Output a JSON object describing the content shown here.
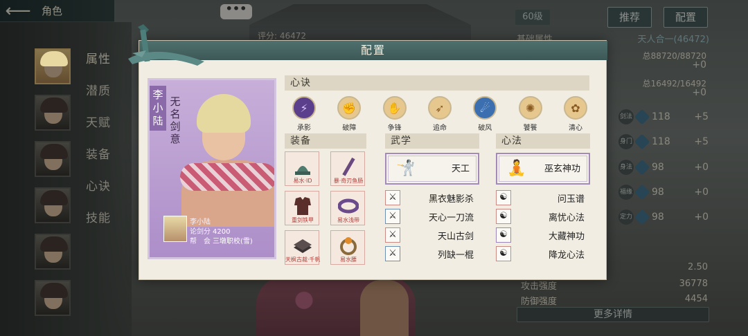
{
  "topbar": {
    "back_icon": "arrow-left-icon",
    "title": "角色"
  },
  "sidebar": {
    "menu": [
      "属性",
      "潜质",
      "天赋",
      "装备",
      "心诀",
      "技能"
    ]
  },
  "chat": {
    "label": "•••"
  },
  "background_panel": {
    "score": "评分: 46472",
    "level": "60级",
    "buttons": {
      "recommend": "推荐",
      "config": "配置"
    },
    "basic_attr": "基础属性",
    "realm": "天人合一(46472)",
    "hp": "总88720/88720",
    "hp_plus": "+0",
    "mp": "总16492/16492",
    "mp_plus": "+0",
    "attrs": [
      {
        "icon": "剑法",
        "value": "118",
        "plus": "+5"
      },
      {
        "icon": "身门",
        "value": "118",
        "plus": "+5"
      },
      {
        "icon": "身法",
        "value": "98",
        "plus": "+0"
      },
      {
        "icon": "福缘",
        "value": "98",
        "plus": "+0"
      },
      {
        "icon": "定力",
        "value": "98",
        "plus": "+0"
      }
    ],
    "bottom_stats": [
      {
        "label": "",
        "value": "2.50"
      },
      {
        "label": "攻击强度",
        "value": "36778"
      },
      {
        "label": "防御强度",
        "value": "4454"
      }
    ],
    "more": "更多详情"
  },
  "modal": {
    "title": "配置",
    "card": {
      "name": "李小陆",
      "title": "无名剑意",
      "info_name": "李小陆",
      "sword_label": "论剑分",
      "sword_value": "4200",
      "guild_label": "帮　会",
      "guild_value": "三墩职校(雪)"
    },
    "sections": {
      "xinjue": "心诀",
      "equip": "装备",
      "wuxue": "武学",
      "xinfa": "心法"
    },
    "xinjue": [
      {
        "label": "承影",
        "icon": "blade-icon",
        "color": "#5b3f8c"
      },
      {
        "label": "破障",
        "icon": "fist-icon",
        "color": "#c98b3d"
      },
      {
        "label": "争锋",
        "icon": "palm-icon",
        "color": "#c98b3d"
      },
      {
        "label": "追命",
        "icon": "strike-icon",
        "color": "#c98b3d"
      },
      {
        "label": "破风",
        "icon": "wind-icon",
        "color": "#3c6fb0"
      },
      {
        "label": "饕餮",
        "icon": "beast-icon",
        "color": "#c98b3d"
      },
      {
        "label": "清心",
        "icon": "lotus-icon",
        "color": "#c98b3d"
      }
    ],
    "equip": [
      {
        "label": "易水·ID",
        "shape": "hat"
      },
      {
        "label": "暴·奇刃鱼肠",
        "shape": "blade"
      },
      {
        "label": "重剑铁甲",
        "shape": "armor"
      },
      {
        "label": "易水浅带",
        "shape": "belt"
      },
      {
        "label": "天枫古裁·千帆",
        "shape": "book"
      },
      {
        "label": "易水腰",
        "shape": "ring"
      }
    ],
    "wuxue_main": {
      "icon": "sword-dancer-icon",
      "name": "天工"
    },
    "xinfa_main": {
      "icon": "meditation-icon",
      "name": "巫玄神功"
    },
    "wuxue_list": [
      {
        "name": "黑衣魅影杀",
        "frame": "red"
      },
      {
        "name": "天心一刀流",
        "frame": "blue"
      },
      {
        "name": "天山古剑",
        "frame": "red"
      },
      {
        "name": "列缺一棍",
        "frame": "blue"
      }
    ],
    "xinfa_list": [
      {
        "name": "问玉谱",
        "frame": "red"
      },
      {
        "name": "离忧心法",
        "frame": "red"
      },
      {
        "name": "大藏神功",
        "frame": "purple"
      },
      {
        "name": "降龙心法",
        "frame": "red"
      }
    ]
  }
}
